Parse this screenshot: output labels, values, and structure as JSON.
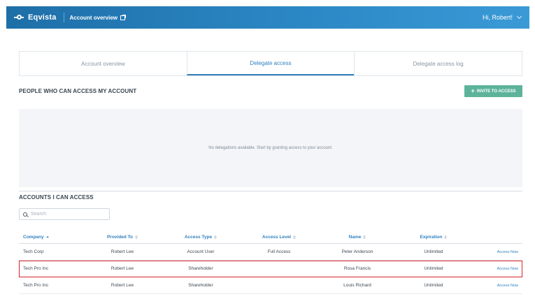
{
  "header": {
    "brand": "Eqvista",
    "nav_link": "Account overview",
    "user_greeting": "Hi, Robert!"
  },
  "tabs": [
    {
      "label": "Account overview",
      "active": false
    },
    {
      "label": "Delegate access",
      "active": true
    },
    {
      "label": "Delegate access log",
      "active": false
    }
  ],
  "delegates_section": {
    "title": "PEOPLE WHO CAN ACCESS MY ACCOUNT",
    "invite_button": "INVITE TO ACCESS",
    "empty_message": "No delegations available. Start by granting access to your account."
  },
  "accounts_section": {
    "title": "ACCOUNTS I CAN ACCESS",
    "search_placeholder": "Search",
    "columns": [
      "Company",
      "Provided To",
      "Access Type",
      "Access Level",
      "Name",
      "Expiration"
    ],
    "rows": [
      {
        "company": "Tech Corp",
        "provided_to": "Robert Lee",
        "access_type": "Account User",
        "access_level": "Full Access",
        "name": "Peter Anderson",
        "expiration": "Unlimited",
        "action": "Access Now"
      },
      {
        "company": "Tech Pro Inc",
        "provided_to": "Robert Lee",
        "access_type": "Shareholder",
        "access_level": "",
        "name": "Rosa Francis",
        "expiration": "Unlimited",
        "action": "Access Now"
      },
      {
        "company": "Tech Pro Inc",
        "provided_to": "Robert Lee",
        "access_type": "Shareholder",
        "access_level": "",
        "name": "Louis Richard",
        "expiration": "Unlimited",
        "action": "Access Now"
      }
    ]
  },
  "colors": {
    "header_blue": "#2b87c4",
    "accent_blue": "#2f80bf",
    "invite_green": "#5cb39a",
    "highlight_red": "#d8232a"
  }
}
